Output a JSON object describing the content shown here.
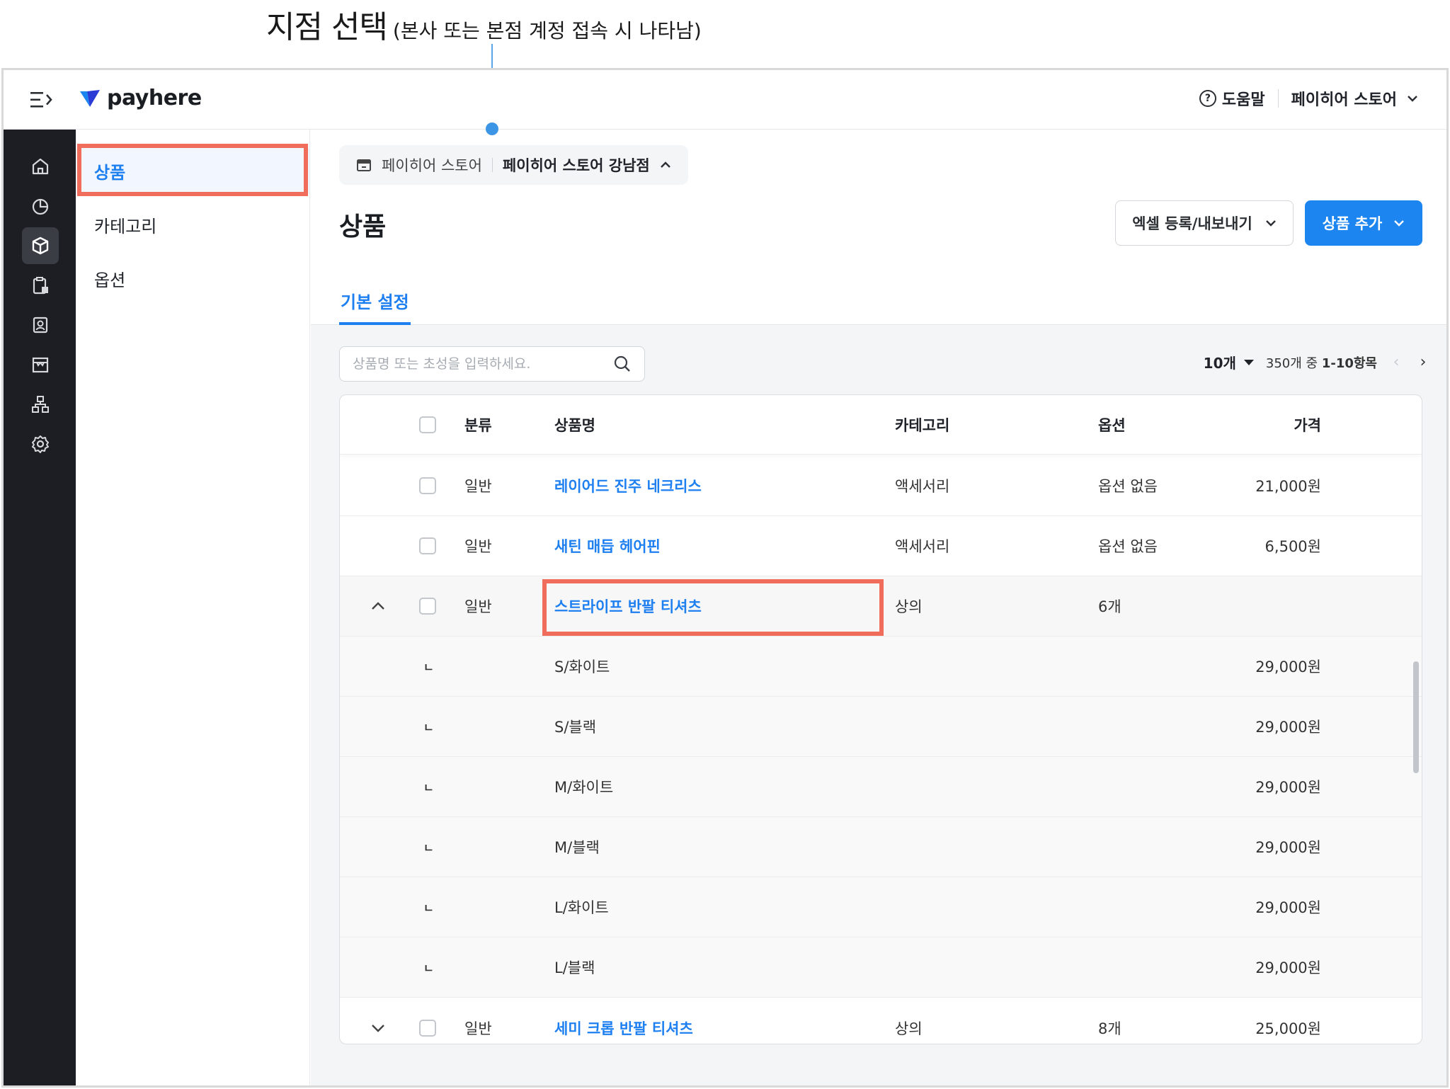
{
  "annotation": {
    "title": "지점 선택",
    "subtitle": "(본사 또는 본점 계정 접속 시 나타남)"
  },
  "topbar": {
    "logo": "payhere",
    "help": "도움말",
    "store": "페이히어 스토어"
  },
  "sidebar_icons": [
    "home-icon",
    "chart-icon",
    "product-box-icon",
    "clipboard-icon",
    "customer-icon",
    "store-icon",
    "org-icon",
    "settings-icon"
  ],
  "subnav": {
    "items": [
      {
        "label": "상품"
      },
      {
        "label": "카테고리"
      },
      {
        "label": "옵션"
      }
    ]
  },
  "breadcrumb": {
    "parent": "페이히어 스토어",
    "current": "페이히어 스토어 강남점"
  },
  "page": {
    "title": "상품",
    "excel_button": "엑셀 등록/내보내기",
    "add_button": "상품 추가",
    "tab": "기본 설정"
  },
  "search": {
    "placeholder": "상품명 또는 초성을 입력하세요."
  },
  "pager": {
    "page_size": "10개",
    "range_prefix": "350개 중 ",
    "range": "1-10항목"
  },
  "table": {
    "headers": {
      "type": "분류",
      "name": "상품명",
      "category": "카테고리",
      "option": "옵션",
      "price": "가격"
    },
    "rows": [
      {
        "type": "일반",
        "name": "레이어드 진주 네크리스",
        "category": "액세서리",
        "option": "옵션 없음",
        "price": "21,000원"
      },
      {
        "type": "일반",
        "name": "새틴 매듭 헤어핀",
        "category": "액세서리",
        "option": "옵션 없음",
        "price": "6,500원"
      },
      {
        "type": "일반",
        "name": "스트라이프 반팔 티셔츠",
        "category": "상의",
        "option": "6개",
        "price": ""
      },
      {
        "type": "",
        "name": "S/화이트",
        "category": "",
        "option": "",
        "price": "29,000원"
      },
      {
        "type": "",
        "name": "S/블랙",
        "category": "",
        "option": "",
        "price": "29,000원"
      },
      {
        "type": "",
        "name": "M/화이트",
        "category": "",
        "option": "",
        "price": "29,000원"
      },
      {
        "type": "",
        "name": "M/블랙",
        "category": "",
        "option": "",
        "price": "29,000원"
      },
      {
        "type": "",
        "name": "L/화이트",
        "category": "",
        "option": "",
        "price": "29,000원"
      },
      {
        "type": "",
        "name": "L/블랙",
        "category": "",
        "option": "",
        "price": "29,000원"
      },
      {
        "type": "일반",
        "name": "세미 크롭 반팔 티셔츠",
        "category": "상의",
        "option": "8개",
        "price": "25,000원"
      }
    ],
    "sub_marker": "ㄴ"
  },
  "colors": {
    "accent": "#1d85f0",
    "highlight": "#f06d5b",
    "sidebar_bg": "#1c1e23"
  }
}
